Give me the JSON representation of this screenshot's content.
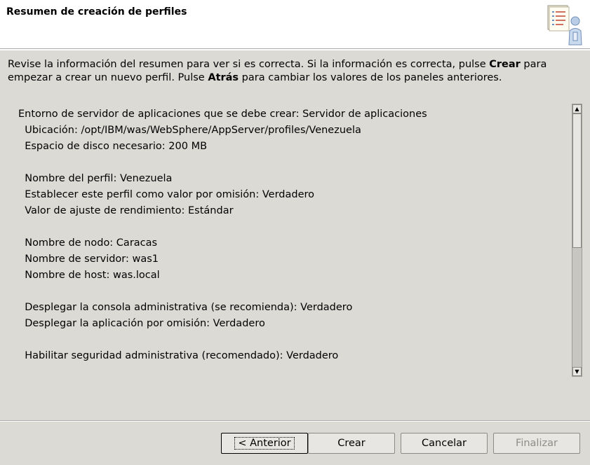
{
  "header": {
    "title": "Resumen de creación de perfiles"
  },
  "description": {
    "part1": "Revise la información del resumen para ver si es correcta. Si la información es correcta, pulse ",
    "bold1": "Crear",
    "part2": " para empezar a crear un nuevo perfil. Pulse ",
    "bold2": "Atrás",
    "part3": " para cambiar los valores de los paneles anteriores."
  },
  "summary": {
    "lines": [
      "Entorno de servidor de aplicaciones que se debe crear: Servidor de aplicaciones",
      "  Ubicación: /opt/IBM/was/WebSphere/AppServer/profiles/Venezuela",
      "  Espacio de disco necesario: 200 MB",
      "",
      "  Nombre del perfil: Venezuela",
      "  Establecer este perfil como valor por omisión: Verdadero",
      "  Valor de ajuste de rendimiento: Estándar",
      "",
      "  Nombre de nodo: Caracas",
      "  Nombre de servidor: was1",
      "  Nombre de host: was.local",
      "",
      "  Desplegar la consola administrativa (se recomienda): Verdadero",
      "  Desplegar la aplicación por omisión: Verdadero",
      "",
      "  Habilitar seguridad administrativa (recomendado): Verdadero"
    ]
  },
  "buttons": {
    "back": "< Anterior",
    "create": "Crear",
    "cancel": "Cancelar",
    "finish": "Finalizar"
  }
}
